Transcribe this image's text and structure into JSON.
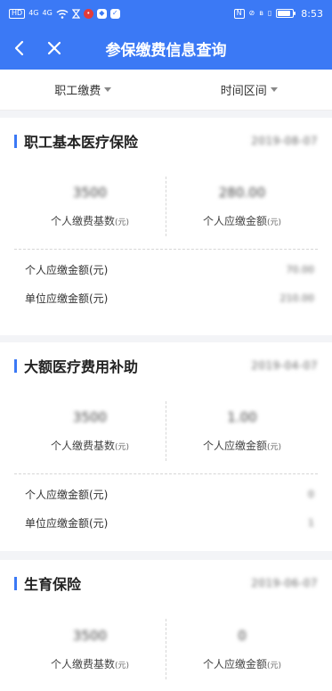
{
  "status_bar": {
    "left_icons": [
      "HD",
      "4G",
      "4G",
      "wifi-icon",
      "hourglass-icon",
      "red-dot-icon",
      "shield-icon",
      "app-badge-icon"
    ],
    "right_icons": [
      "nfc-icon",
      "silent-icon",
      "bluetooth-icon",
      "vibrate-icon"
    ],
    "time": "8:53",
    "battery_level": 0.85
  },
  "nav": {
    "title": "参保缴费信息查询"
  },
  "filters": [
    {
      "label": "职工缴费"
    },
    {
      "label": "时间区间"
    }
  ],
  "colors": {
    "primary": "#3b79f5",
    "background": "#f3f4f7"
  },
  "cards": [
    {
      "title": "职工基本医疗保险",
      "date": "2019-08-07",
      "summary": [
        {
          "value": "3500",
          "label": "个人缴费基数",
          "unit": "(元)"
        },
        {
          "value": "280.00",
          "label": "个人应缴金额",
          "unit": "(元)"
        }
      ],
      "details": [
        {
          "label": "个人应缴金额(元)",
          "value": "70.00"
        },
        {
          "label": "单位应缴金额(元)",
          "value": "210.00"
        }
      ]
    },
    {
      "title": "大额医疗费用补助",
      "date": "2019-04-07",
      "summary": [
        {
          "value": "3500",
          "label": "个人缴费基数",
          "unit": "(元)"
        },
        {
          "value": "1.00",
          "label": "个人应缴金额",
          "unit": "(元)"
        }
      ],
      "details": [
        {
          "label": "个人应缴金额(元)",
          "value": "0"
        },
        {
          "label": "单位应缴金额(元)",
          "value": "1"
        }
      ]
    },
    {
      "title": "生育保险",
      "date": "2019-06-07",
      "summary": [
        {
          "value": "3500",
          "label": "个人缴费基数",
          "unit": "(元)"
        },
        {
          "value": "0",
          "label": "个人应缴金额",
          "unit": "(元)"
        }
      ]
    }
  ]
}
